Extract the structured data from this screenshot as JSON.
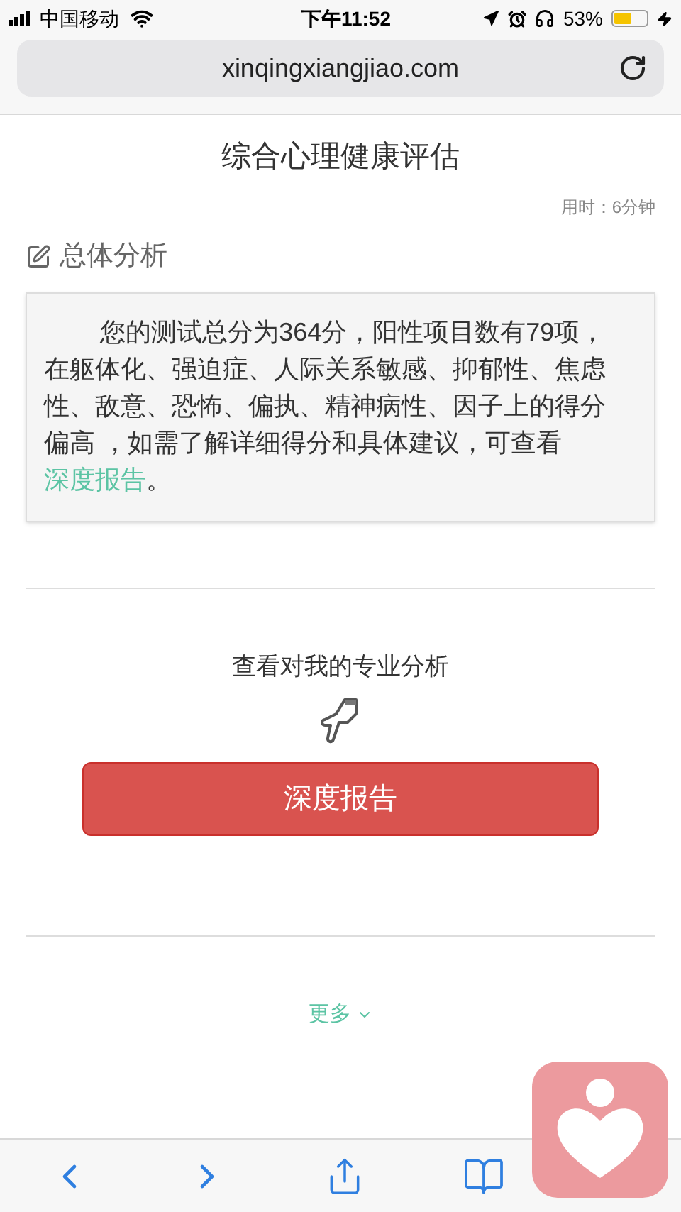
{
  "status_bar": {
    "carrier": "中国移动",
    "time": "下午11:52",
    "battery": "53%"
  },
  "address_bar": {
    "url": "xinqingxiangjiao.com"
  },
  "page": {
    "title": "综合心理健康评估",
    "duration": "用时：6分钟",
    "section_title": "总体分析",
    "summary": {
      "text": "您的测试总分为364分，阳性项目数有79项，在躯体化、强迫症、人际关系敏感、抑郁性、焦虑性、敌意、恐怖、偏执、精神病性、因子上的得分偏高 ，如需了解详细得分和具体建议，可查看",
      "link": "深度报告",
      "text_after": "。"
    },
    "prompt": "查看对我的专业分析",
    "report_button": "深度报告",
    "more": "更多"
  }
}
